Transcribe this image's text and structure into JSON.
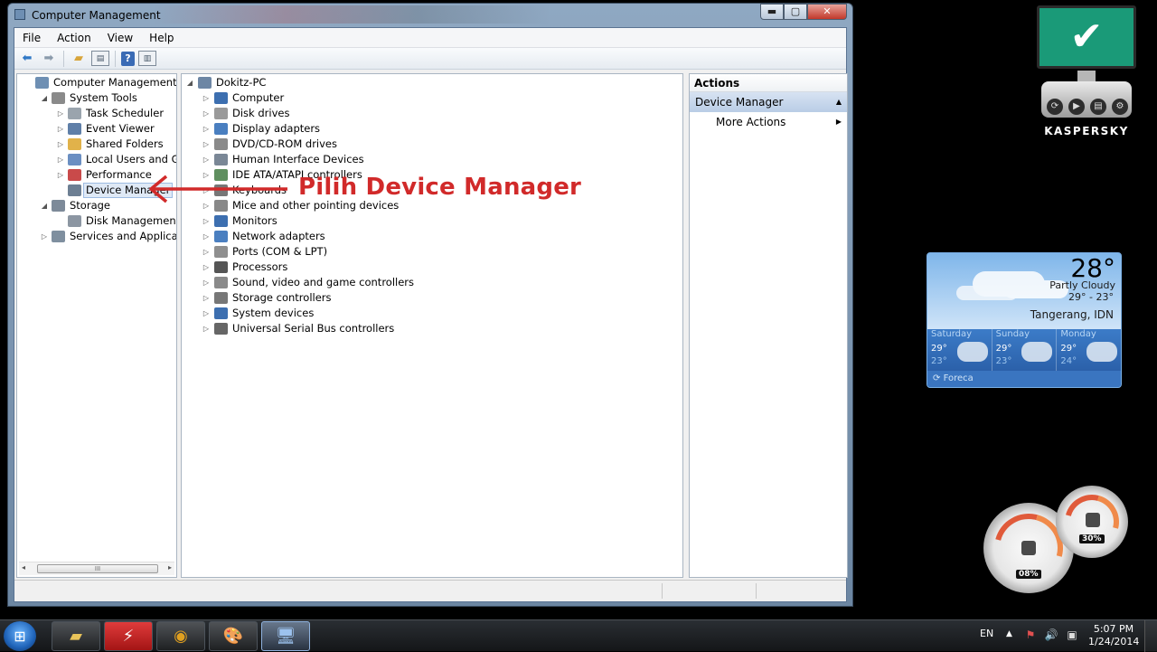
{
  "window": {
    "title": "Computer Management",
    "controls": {
      "minimize": "▬",
      "maximize": "▢",
      "close": "✕"
    }
  },
  "menu": [
    "File",
    "Action",
    "View",
    "Help"
  ],
  "left_tree": [
    {
      "label": "Computer Management (Local",
      "level": 0,
      "exp": "",
      "icon": "computer-management-icon",
      "color": "#6e8fb3"
    },
    {
      "label": "System Tools",
      "level": 1,
      "exp": "◢",
      "icon": "tools-icon",
      "color": "#8a8a8a"
    },
    {
      "label": "Task Scheduler",
      "level": 2,
      "exp": "▷",
      "icon": "clock-icon",
      "color": "#9aa4ad"
    },
    {
      "label": "Event Viewer",
      "level": 2,
      "exp": "▷",
      "icon": "event-viewer-icon",
      "color": "#5f7fa8"
    },
    {
      "label": "Shared Folders",
      "level": 2,
      "exp": "▷",
      "icon": "shared-folder-icon",
      "color": "#e1b24a"
    },
    {
      "label": "Local Users and Groups",
      "level": 2,
      "exp": "▷",
      "icon": "users-icon",
      "color": "#6b8fc2"
    },
    {
      "label": "Performance",
      "level": 2,
      "exp": "▷",
      "icon": "performance-icon",
      "color": "#c94a4a"
    },
    {
      "label": "Device Manager",
      "level": 2,
      "exp": "",
      "icon": "device-manager-icon",
      "color": "#6d7f93",
      "selected": true
    },
    {
      "label": "Storage",
      "level": 1,
      "exp": "◢",
      "icon": "storage-icon",
      "color": "#7d8a99"
    },
    {
      "label": "Disk Management",
      "level": 2,
      "exp": "",
      "icon": "disk-icon",
      "color": "#8c96a2"
    },
    {
      "label": "Services and Applications",
      "level": 1,
      "exp": "▷",
      "icon": "services-icon",
      "color": "#7f8f9f"
    }
  ],
  "scrollbar": {
    "left": "◂",
    "right": "▸",
    "grip": "III"
  },
  "device_tree": {
    "root": "Dokitz-PC",
    "items": [
      {
        "label": "Computer",
        "icon": "computer-icon",
        "color": "#3d6fb0"
      },
      {
        "label": "Disk drives",
        "icon": "disk-drive-icon",
        "color": "#9a9a9a"
      },
      {
        "label": "Display adapters",
        "icon": "display-adapter-icon",
        "color": "#4a7fc0"
      },
      {
        "label": "DVD/CD-ROM drives",
        "icon": "dvd-icon",
        "color": "#8a8a8a"
      },
      {
        "label": "Human Interface Devices",
        "icon": "hid-icon",
        "color": "#7a8796"
      },
      {
        "label": "IDE ATA/ATAPI controllers",
        "icon": "ide-icon",
        "color": "#5f8f5f"
      },
      {
        "label": "Keyboards",
        "icon": "keyboard-icon",
        "color": "#777777"
      },
      {
        "label": "Mice and other pointing devices",
        "icon": "mouse-icon",
        "color": "#888888"
      },
      {
        "label": "Monitors",
        "icon": "monitor-icon",
        "color": "#3d6fb0"
      },
      {
        "label": "Network adapters",
        "icon": "network-icon",
        "color": "#4a7fc0"
      },
      {
        "label": "Ports (COM & LPT)",
        "icon": "port-icon",
        "color": "#8f8f8f"
      },
      {
        "label": "Processors",
        "icon": "processor-icon",
        "color": "#555555"
      },
      {
        "label": "Sound, video and game controllers",
        "icon": "sound-icon",
        "color": "#8a8a8a"
      },
      {
        "label": "Storage controllers",
        "icon": "storage-controller-icon",
        "color": "#777777"
      },
      {
        "label": "System devices",
        "icon": "system-devices-icon",
        "color": "#3d6fb0"
      },
      {
        "label": "Universal Serial Bus controllers",
        "icon": "usb-icon",
        "color": "#666666"
      }
    ]
  },
  "actions": {
    "header": "Actions",
    "section": "Device Manager",
    "more": "More Actions"
  },
  "annotation": {
    "text": "Pilih Device Manager",
    "color": "#d12a2a"
  },
  "kaspersky": {
    "logo": "KASPERSKY",
    "check": "✔"
  },
  "weather": {
    "temp": "28°",
    "condition": "Partly Cloudy",
    "range": "29° - 23°",
    "city": "Tangerang, IDN",
    "days": [
      {
        "name": "Saturday",
        "hi": "29°",
        "lo": "23°"
      },
      {
        "name": "Sunday",
        "hi": "29°",
        "lo": "23°"
      },
      {
        "name": "Monday",
        "hi": "29°",
        "lo": "24°"
      }
    ],
    "provider": "Foreca"
  },
  "gauges": {
    "cpu": "08%",
    "memory": "30%"
  },
  "taskbar": {
    "lang": "EN",
    "time": "5:07 PM",
    "date": "1/24/2014"
  }
}
